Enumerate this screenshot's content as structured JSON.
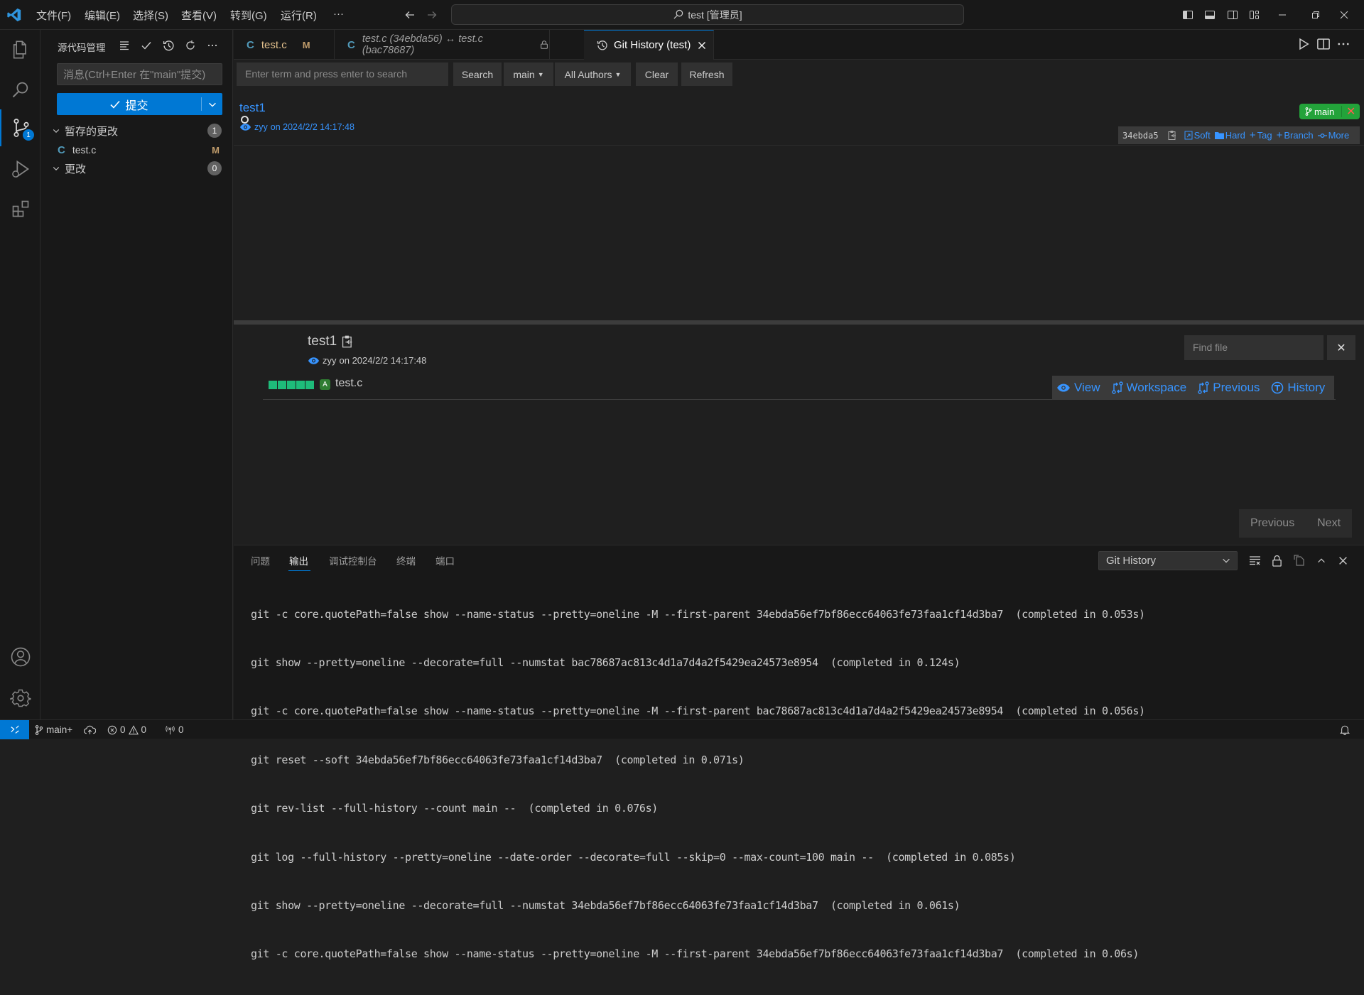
{
  "titlebar": {
    "menus": [
      "文件(F)",
      "编辑(E)",
      "选择(S)",
      "查看(V)",
      "转到(G)",
      "运行(R)",
      "···"
    ],
    "command_center": "test [管理员]"
  },
  "activity": {
    "scm_badge": "1"
  },
  "sidebar": {
    "title": "源代码管理",
    "commit_placeholder": "消息(Ctrl+Enter 在\"main\"提交)",
    "commit_label": "提交",
    "staged": {
      "label": "暂存的更改",
      "count": "1"
    },
    "staged_file": {
      "icon": "C",
      "name": "test.c",
      "status": "M"
    },
    "changes": {
      "label": "更改",
      "count": "0"
    }
  },
  "tabs": [
    {
      "icon": "C",
      "label": "test.c",
      "status": "M"
    },
    {
      "icon": "C",
      "label": "test.c (34ebda56) ↔ test.c (bac78687)"
    },
    {
      "label": "Git History (test)"
    }
  ],
  "toolbar": {
    "search_placeholder": "Enter term and press enter to search",
    "search": "Search",
    "branch": "main",
    "authors": "All Authors",
    "clear": "Clear",
    "refresh": "Refresh"
  },
  "commit": {
    "title": "test1",
    "author": "zyy",
    "date": "on 2024/2/2 14:17:48",
    "branch_tag": "main",
    "hash": "34ebda5",
    "actions": [
      "Soft",
      "Hard",
      "Tag",
      "Branch",
      "More"
    ]
  },
  "details": {
    "title": "test1",
    "author": "zyy",
    "date": "on 2024/2/2 14:17:48",
    "find_placeholder": "Find file",
    "file": {
      "status": "A",
      "name": "test.c"
    },
    "file_actions": [
      "View",
      "Workspace",
      "Previous",
      "History"
    ],
    "pager": {
      "previous": "Previous",
      "next": "Next"
    }
  },
  "panel": {
    "tabs": [
      "问题",
      "输出",
      "调试控制台",
      "终端",
      "端口"
    ],
    "active_tab": "输出",
    "output_channel": "Git History",
    "log": [
      "git -c core.quotePath=false show --name-status --pretty=oneline -M --first-parent 34ebda56ef7bf86ecc64063fe73faa1cf14d3ba7  (completed in 0.053s)",
      "git show --pretty=oneline --decorate=full --numstat bac78687ac813c4d1a7d4a2f5429ea24573e8954  (completed in 0.124s)",
      "git -c core.quotePath=false show --name-status --pretty=oneline -M --first-parent bac78687ac813c4d1a7d4a2f5429ea24573e8954  (completed in 0.056s)",
      "git reset --soft 34ebda56ef7bf86ecc64063fe73faa1cf14d3ba7  (completed in 0.071s)",
      "git rev-list --full-history --count main --  (completed in 0.076s)",
      "git log --full-history --pretty=oneline --date-order --decorate=full --skip=0 --max-count=100 main --  (completed in 0.085s)",
      "git show --pretty=oneline --decorate=full --numstat 34ebda56ef7bf86ecc64063fe73faa1cf14d3ba7  (completed in 0.061s)",
      "git -c core.quotePath=false show --name-status --pretty=oneline -M --first-parent 34ebda56ef7bf86ecc64063fe73faa1cf14d3ba7  (completed in 0.06s)"
    ]
  },
  "statusbar": {
    "branch": "main+",
    "errors": "0",
    "warnings": "0",
    "ports": "0"
  }
}
